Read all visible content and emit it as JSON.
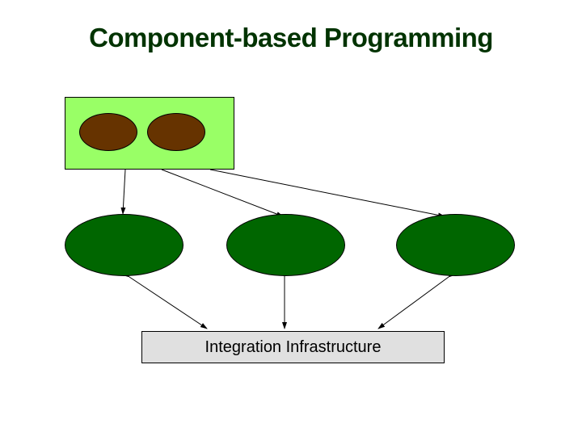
{
  "title": "Component-based Programming",
  "infra_label": "Integration Infrastructure",
  "shapes": {
    "container_box": {
      "fill": "#99ff66"
    },
    "small_ovals": {
      "fill": "#663300",
      "count": 2
    },
    "large_ovals": {
      "fill": "#006600",
      "count": 3
    },
    "infra_box": {
      "fill": "#e0e0e0"
    }
  }
}
